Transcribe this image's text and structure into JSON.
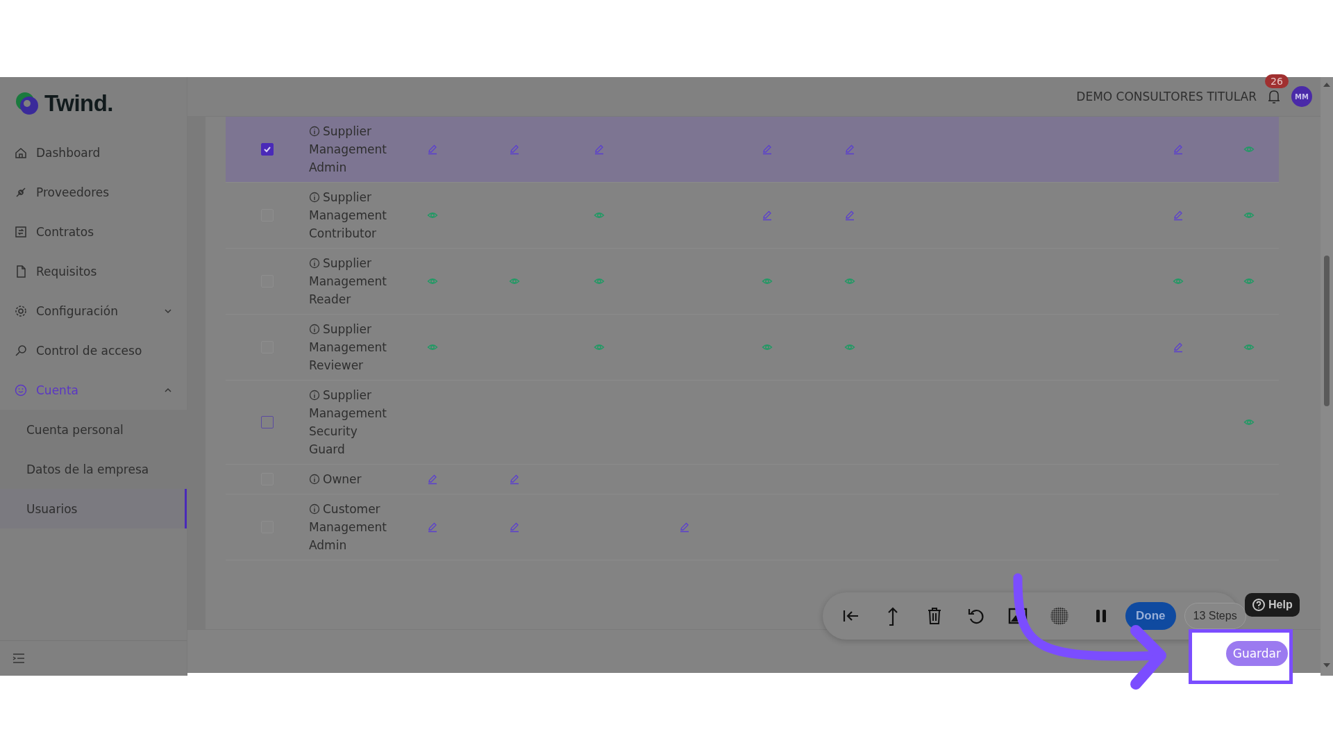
{
  "logo": {
    "text": "Twind."
  },
  "sidebar": {
    "items": [
      {
        "label": "Dashboard",
        "kind": "link",
        "selected": false
      },
      {
        "label": "Proveedores",
        "kind": "link",
        "selected": false
      },
      {
        "label": "Contratos",
        "kind": "link",
        "selected": false
      },
      {
        "label": "Requisitos",
        "kind": "link",
        "selected": false
      },
      {
        "label": "Configuración",
        "kind": "group",
        "selected": false,
        "expanded": false
      },
      {
        "label": "Control de acceso",
        "kind": "link",
        "selected": false
      },
      {
        "label": "Cuenta",
        "kind": "group",
        "selected": true,
        "expanded": true,
        "children": [
          {
            "label": "Cuenta personal",
            "selected": false
          },
          {
            "label": "Datos de la empresa",
            "selected": false
          },
          {
            "label": "Usuarios",
            "selected": true
          }
        ]
      }
    ]
  },
  "header": {
    "company": "DEMO CONSULTORES TITULAR",
    "notifications": "26",
    "avatar": "MM"
  },
  "table": {
    "rows": [
      {
        "label": "Supplier Management Admin",
        "checked": true,
        "disabled": false,
        "selected": true,
        "cells": [
          {
            "kind": "edit"
          },
          {
            "kind": "edit"
          },
          {
            "kind": "edit"
          },
          {
            "kind": "empty"
          },
          {
            "kind": "edit"
          },
          {
            "kind": "edit"
          },
          {
            "kind": "edit"
          },
          {
            "kind": "view"
          }
        ]
      },
      {
        "label": "Supplier Management Contributor",
        "checked": false,
        "disabled": true,
        "selected": false,
        "cells": [
          {
            "kind": "view"
          },
          {
            "kind": "empty"
          },
          {
            "kind": "view"
          },
          {
            "kind": "empty"
          },
          {
            "kind": "edit"
          },
          {
            "kind": "edit"
          },
          {
            "kind": "edit"
          },
          {
            "kind": "view"
          }
        ]
      },
      {
        "label": "Supplier Management Reader",
        "checked": false,
        "disabled": true,
        "selected": false,
        "cells": [
          {
            "kind": "view"
          },
          {
            "kind": "view"
          },
          {
            "kind": "view"
          },
          {
            "kind": "empty"
          },
          {
            "kind": "view"
          },
          {
            "kind": "view"
          },
          {
            "kind": "view"
          },
          {
            "kind": "view"
          }
        ]
      },
      {
        "label": "Supplier Management Reviewer",
        "checked": false,
        "disabled": true,
        "selected": false,
        "cells": [
          {
            "kind": "view"
          },
          {
            "kind": "empty"
          },
          {
            "kind": "view"
          },
          {
            "kind": "empty"
          },
          {
            "kind": "view"
          },
          {
            "kind": "view"
          },
          {
            "kind": "edit"
          },
          {
            "kind": "view"
          }
        ]
      },
      {
        "label": "Supplier Management Security Guard",
        "checked": false,
        "disabled": false,
        "selected": false,
        "cells": [
          {
            "kind": "empty"
          },
          {
            "kind": "empty"
          },
          {
            "kind": "empty"
          },
          {
            "kind": "empty"
          },
          {
            "kind": "empty"
          },
          {
            "kind": "empty"
          },
          {
            "kind": "empty"
          },
          {
            "kind": "view"
          }
        ]
      },
      {
        "label": "Owner",
        "checked": false,
        "disabled": true,
        "selected": false,
        "cells": [
          {
            "kind": "edit"
          },
          {
            "kind": "edit"
          },
          {
            "kind": "empty"
          },
          {
            "kind": "empty"
          },
          {
            "kind": "empty"
          },
          {
            "kind": "empty"
          },
          {
            "kind": "empty"
          },
          {
            "kind": "empty"
          }
        ]
      },
      {
        "label": "Customer Management Admin",
        "checked": false,
        "disabled": true,
        "selected": false,
        "cells": [
          {
            "kind": "edit"
          },
          {
            "kind": "edit"
          },
          {
            "kind": "empty"
          },
          {
            "kind": "edit"
          },
          {
            "kind": "empty"
          },
          {
            "kind": "empty"
          },
          {
            "kind": "empty"
          },
          {
            "kind": "empty"
          }
        ]
      }
    ]
  },
  "footer": {
    "save_button": "Guardar"
  },
  "tour": {
    "done": "Done",
    "steps": "13 Steps",
    "help": "Help"
  }
}
